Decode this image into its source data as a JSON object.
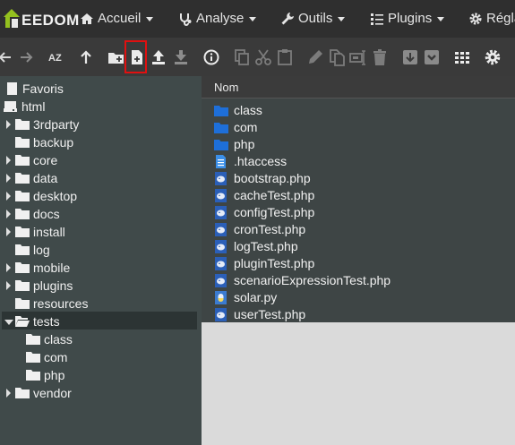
{
  "brand": {
    "logo_text": "EEDOM"
  },
  "nav": {
    "items": [
      {
        "label": "Accueil",
        "icon": "home-icon"
      },
      {
        "label": "Analyse",
        "icon": "stethoscope-icon"
      },
      {
        "label": "Outils",
        "icon": "wrench-icon"
      },
      {
        "label": "Plugins",
        "icon": "list-icon"
      },
      {
        "label": "Régla",
        "icon": "cog-icon"
      }
    ]
  },
  "toolbar": {
    "icons": [
      "back-arrow-icon",
      "forward-arrow-icon",
      "sort-az-icon",
      "up-arrow-icon",
      "new-folder-icon",
      "new-file-icon",
      "upload-icon",
      "download-icon",
      "info-icon",
      "copy-icon",
      "cut-icon",
      "paste-icon",
      "edit-icon",
      "duplicate-icon",
      "rename-icon",
      "trash-icon",
      "archive-icon",
      "extract-icon",
      "grid-view-icon",
      "settings-icon"
    ],
    "sort_label": "AZ",
    "highlighted": "new-file-icon",
    "highlight_color": "#e01010"
  },
  "tree": {
    "favorites": "Favoris",
    "root": "html",
    "folders": [
      "3rdparty",
      "backup",
      "core",
      "data",
      "desktop",
      "docs",
      "install",
      "log",
      "mobile",
      "plugins",
      "resources",
      "tests",
      "vendor"
    ],
    "selected": "tests",
    "tests_children": [
      "class",
      "com",
      "php"
    ]
  },
  "files": {
    "column_header": "Nom",
    "rows": [
      {
        "name": "class",
        "type": "folder"
      },
      {
        "name": "com",
        "type": "folder"
      },
      {
        "name": "php",
        "type": "folder"
      },
      {
        "name": ".htaccess",
        "type": "text"
      },
      {
        "name": "bootstrap.php",
        "type": "php"
      },
      {
        "name": "cacheTest.php",
        "type": "php"
      },
      {
        "name": "configTest.php",
        "type": "php"
      },
      {
        "name": "cronTest.php",
        "type": "php"
      },
      {
        "name": "logTest.php",
        "type": "php"
      },
      {
        "name": "pluginTest.php",
        "type": "php"
      },
      {
        "name": "scenarioExpressionTest.php",
        "type": "php"
      },
      {
        "name": "solar.py",
        "type": "python"
      },
      {
        "name": "userTest.php",
        "type": "php"
      }
    ]
  },
  "colors": {
    "folder_blue": "#1e6fd9",
    "accent": "#94c11f"
  }
}
